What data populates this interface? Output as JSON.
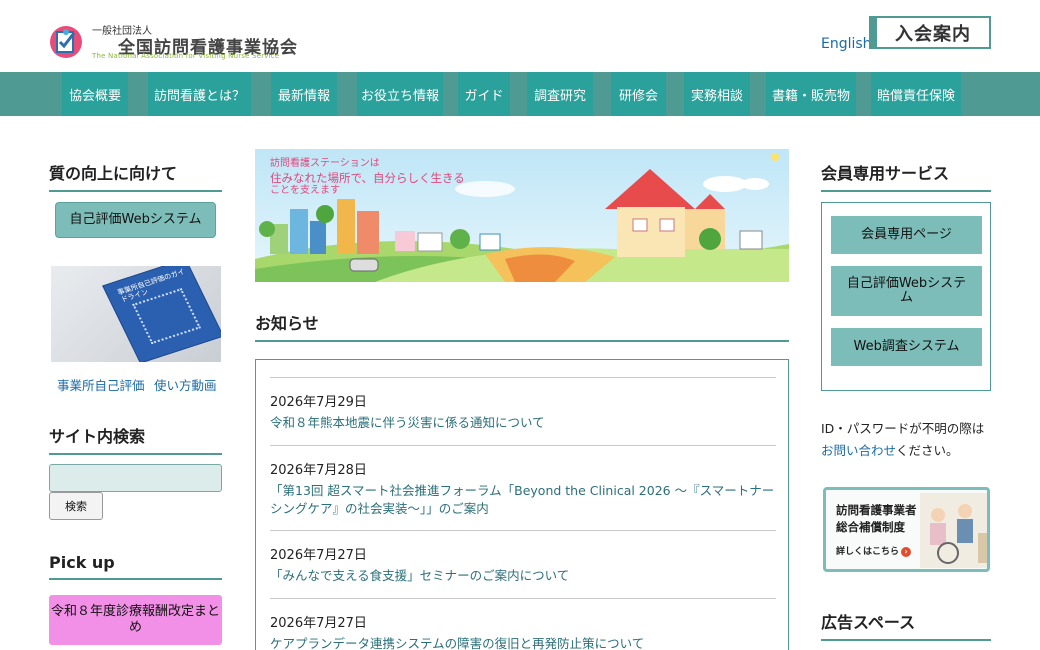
{
  "header": {
    "logo_small": "一般社団法人",
    "logo_main": "全国訪問看護事業協会",
    "logo_en": "The National Association for Visiting Nurse Service",
    "lang_link": "English",
    "join_button": "入会案内",
    "brand_color": "#4f9a93"
  },
  "nav": {
    "items": [
      {
        "label": "協会概要"
      },
      {
        "label": "訪問看護とは？"
      },
      {
        "label": "最新情報"
      },
      {
        "label": "お役立ち情報"
      },
      {
        "label": "ガイド"
      },
      {
        "label": "調査研究"
      },
      {
        "label": "研修会"
      },
      {
        "label": "実務相談"
      },
      {
        "label": "書籍・販売物"
      },
      {
        "label": "賠償責任保険"
      }
    ]
  },
  "left": {
    "quality_title": "質の向上に向けて",
    "self_eval_button": "自己評価Webシステム",
    "book_title": "事業所自己評価のガイドライン",
    "eval_link": "事業所自己評価",
    "video_link": "使い方動画",
    "search_title": "サイト内検索",
    "search_value": "",
    "search_button": "検索",
    "pickup_title": "Pick up",
    "pickup_button": "令和８年度診療報酬改定まとめ"
  },
  "banner": {
    "line1": "訪問看護ステーションは",
    "line2": "住みなれた場所で、自分らしく生きる",
    "line3": "ことを支えます"
  },
  "news": {
    "title": "お知らせ",
    "items": [
      {
        "date": "2026年7月29日",
        "title": "令和８年熊本地震に伴う災害に係る通知について"
      },
      {
        "date": "2026年7月28日",
        "title": "「第13回 超スマート社会推進フォーラム「Beyond the Clinical 2026 〜『スマートナーシングケア』の社会実装〜」」のご案内"
      },
      {
        "date": "2026年7月27日",
        "title": "「みんなで支える食支援」セミナーのご案内について"
      },
      {
        "date": "2026年7月27日",
        "title": "ケアプランデータ連携システムの障害の復旧と再発防止策について"
      }
    ]
  },
  "right": {
    "member_title": "会員専用サービス",
    "member_buttons": [
      "会員専用ページ",
      "自己評価Webシステム",
      "Web調査システム"
    ],
    "id_text_pre": "ID・パスワードが不明の際は",
    "contact_link": "お問い合わせ",
    "id_text_post": "ください。",
    "insurance_title1": "訪問看護事業者",
    "insurance_title2": "総合補償制度",
    "insurance_link": "詳しくはこちら",
    "ad_title": "広告スペース"
  }
}
